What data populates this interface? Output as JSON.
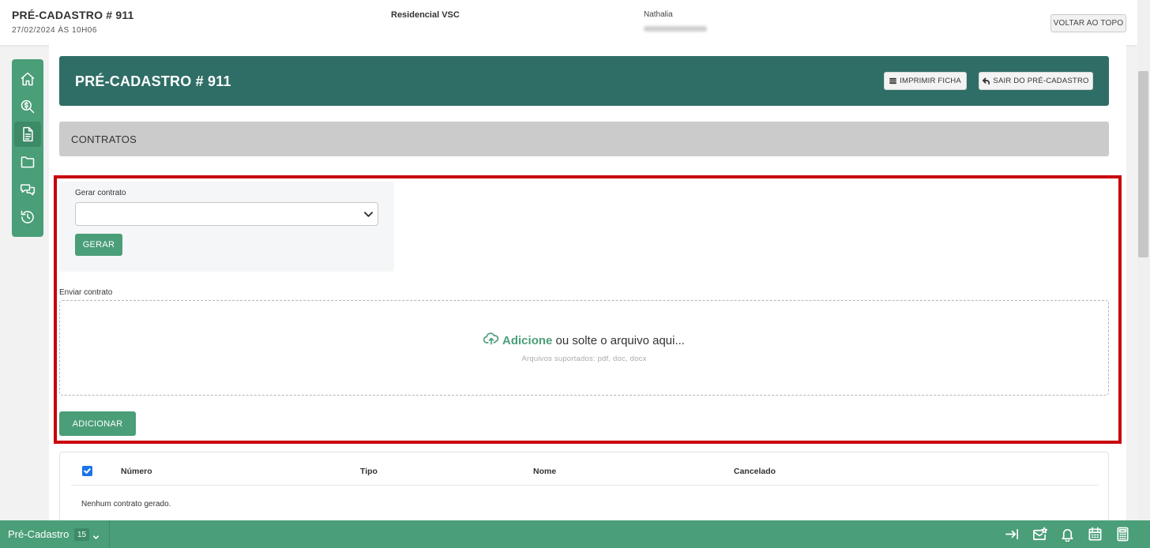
{
  "topbar": {
    "title": "PRÉ-CADASTRO # 911",
    "datetime": "27/02/2024 ÀS 10H06",
    "condominium": "Residencial VSC",
    "user_name": "Nathalia",
    "back_to_top_label": "VOLTAR AO TOPO"
  },
  "sidenav": {
    "items": [
      {
        "icon": "home-icon"
      },
      {
        "icon": "search-money-icon"
      },
      {
        "icon": "document-icon",
        "active": true
      },
      {
        "icon": "folder-icon"
      },
      {
        "icon": "chat-icon"
      },
      {
        "icon": "history-icon"
      }
    ]
  },
  "header": {
    "title": "PRÉ-CADASTRO # 911",
    "print_label": "IMPRIMIR FICHA",
    "exit_label": "SAIR DO PRÉ-CADASTRO"
  },
  "section": {
    "title": "CONTRATOS"
  },
  "generate": {
    "label": "Gerar contrato",
    "selected_value": "",
    "button_label": "GERAR"
  },
  "upload": {
    "label": "Enviar contrato",
    "add_link": "Adicione",
    "drop_text": " ou solte o arquivo aqui...",
    "supported": "Arquivos suportados: pdf, doc, docx",
    "button_label": "ADICIONAR"
  },
  "table": {
    "columns": [
      "Número",
      "Tipo",
      "Nome",
      "Cancelado"
    ],
    "select_all_checked": true,
    "empty_message": "Nenhum contrato gerado."
  },
  "bottombar": {
    "label": "Pré-Cadastro",
    "count": "15",
    "icons": [
      "collapse-right-icon",
      "mail-star-icon",
      "bell-icon",
      "calendar-icon",
      "calculator-icon"
    ]
  },
  "colors": {
    "primary_green": "#4a9e78",
    "header_teal": "#2f6e66",
    "highlight_red": "#c8000a",
    "section_gray": "#cbcbcb"
  }
}
